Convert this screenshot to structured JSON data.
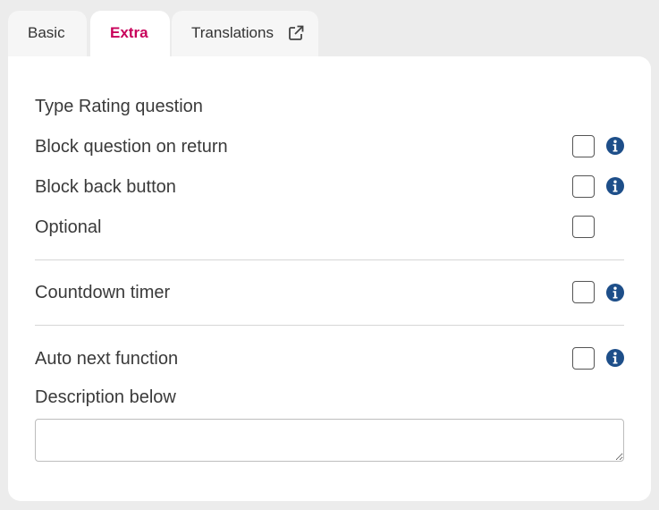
{
  "tabs": [
    {
      "label": "Basic",
      "active": false
    },
    {
      "label": "Extra",
      "active": true
    },
    {
      "label": "Translations",
      "active": false,
      "icon": "external-link-icon"
    }
  ],
  "form": {
    "type_label": "Type Rating question",
    "block_on_return_label": "Block question on return",
    "block_back_label": "Block back button",
    "optional_label": "Optional",
    "countdown_label": "Countdown timer",
    "auto_next_label": "Auto next function",
    "description_label": "Description below",
    "description_value": ""
  },
  "colors": {
    "accent": "#c8005a",
    "info": "#1d4e89",
    "background": "#ececec",
    "panel": "#ffffff"
  }
}
